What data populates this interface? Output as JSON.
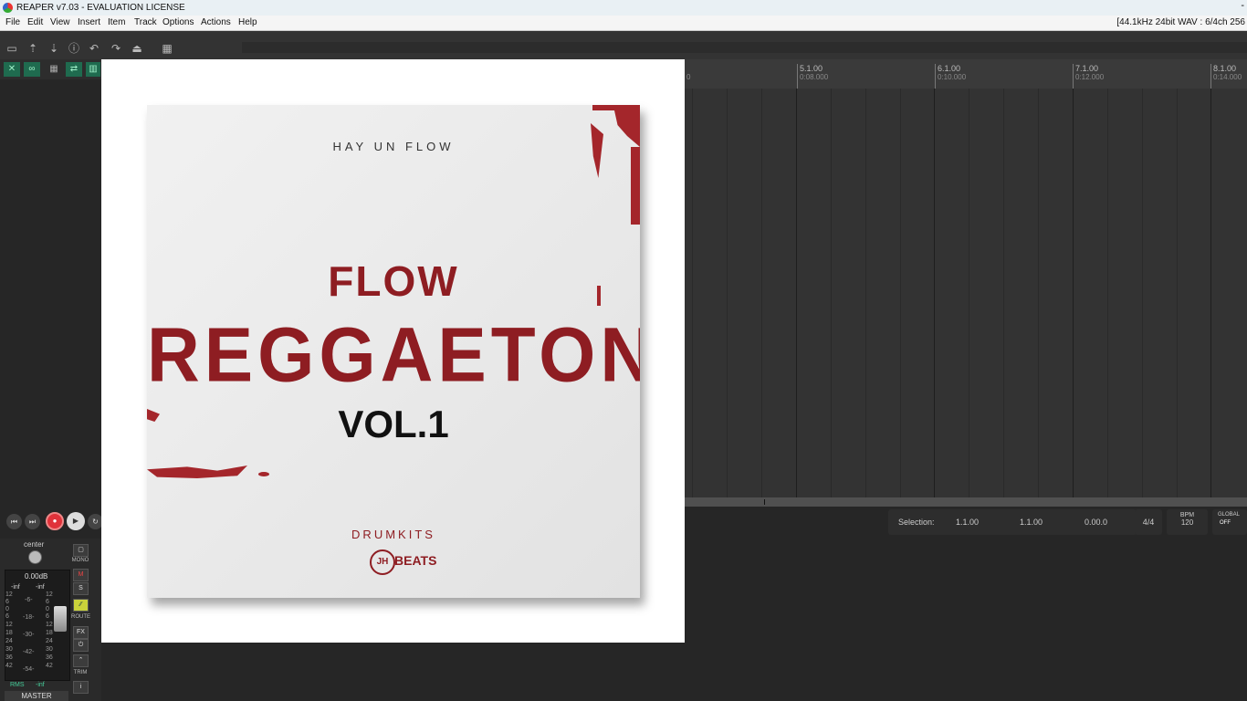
{
  "window": {
    "title": "REAPER v7.03 - EVALUATION LICENSE",
    "minimize_glyph": "-"
  },
  "menu": {
    "items": [
      "File",
      "Edit",
      "View",
      "Insert",
      "Item",
      "Track",
      "Options",
      "Actions",
      "Help"
    ],
    "status": "[44.1kHz 24bit WAV : 6/4ch 256"
  },
  "toolbar": {
    "icons": [
      "new-project-icon",
      "open-project-icon",
      "save-project-icon",
      "project-settings-icon",
      "undo-icon",
      "redo-icon",
      "metronome-icon",
      "grid-icon"
    ]
  },
  "ruler": {
    "marks": [
      {
        "bar": "5.1.00",
        "time": "0:08.000"
      },
      {
        "bar": "6.1.00",
        "time": "0:10.000"
      },
      {
        "bar": "7.1.00",
        "time": "0:12.000"
      },
      {
        "bar": "8.1.00",
        "time": "0:14.000"
      }
    ],
    "partial_label": "0"
  },
  "transport": {
    "selection_label": "Selection:",
    "selection_start": "1.1.00",
    "selection_end": "1.1.00",
    "selection_length": "0.00.0",
    "time_signature": "4/4",
    "bpm_label": "BPM",
    "bpm_value": "120",
    "global_label": "GLOBAL",
    "global_state": "OFF"
  },
  "mixer": {
    "pan": "center",
    "volume": "0.00dB",
    "peak_left": "-inf",
    "peak_right": "-inf",
    "rms_label": "RMS",
    "rms_value": "-inf",
    "mono_label": "MONO",
    "mute_label": "M",
    "solo_label": "S",
    "route_label": "ROUTE",
    "fx_label": "FX",
    "trim_label": "TRIM",
    "info_label": "i",
    "track_name": "MASTER",
    "scale_left": [
      "12",
      "6",
      "0",
      "6",
      "12",
      "18",
      "24",
      "30",
      "36",
      "42"
    ],
    "scale_mid": [
      "-6-",
      "-18-",
      "-30-",
      "-42-",
      "-54-"
    ],
    "scale_right": [
      "12",
      "6",
      "0",
      "6",
      "12",
      "18",
      "24",
      "30",
      "36",
      "42"
    ]
  },
  "cover": {
    "subtitle": "HAY UN FLOW",
    "title_line1": "FLOW",
    "title_line2": "REGGAETON",
    "title_line3": "VOL.1",
    "drumkits": "DRUMKITS",
    "logo_mark": "JH",
    "brand": "BEATS"
  },
  "colors": {
    "accent_red": "#a4262b",
    "record_red": "#e0323a",
    "track_green": "#1f6b4f"
  }
}
